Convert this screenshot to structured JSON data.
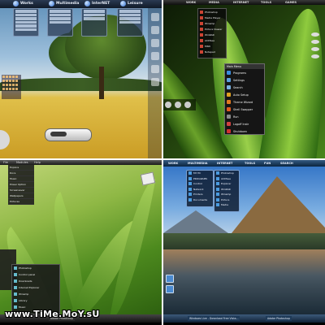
{
  "q1": {
    "tabs": [
      "Works",
      "Multimedia",
      "InterNET",
      "Leisure"
    ],
    "accent": "#2d6bd0"
  },
  "q2": {
    "tabs": [
      "WORK",
      "MEDIA",
      "INTERNET",
      "TOOLS",
      "GAMES"
    ],
    "vpanel_items": [
      "Photoshop",
      "Media Player",
      "Winamp",
      "Picture Viewer",
      "WinRAR",
      "ACDSee",
      "MSN",
      "Notepad"
    ],
    "menu_title": "Main Menu",
    "menu_items": [
      "Programs",
      "Settings",
      "Search",
      "Auto Setup",
      "Theme Wizard",
      "Shell Swapper",
      "Run",
      "Logoff Instr",
      "Shutdown"
    ],
    "menu_colors": [
      "#3a8de0",
      "#5aa0e0",
      "#7ab0e0",
      "#e0a020",
      "#e07a20",
      "#e05a20",
      "#8a8a8a",
      "#d04040",
      "#d03030"
    ]
  },
  "q3": {
    "tabs": [
      "File",
      "Modules",
      "Help"
    ],
    "left_menu_items": [
      "Explore",
      "Docs",
      "Music",
      "Power Option",
      "Screensaver",
      "Wallpapers",
      "Pictures"
    ],
    "bottom_menu_items": [
      "Photoshop",
      "Control panel",
      "Downloads",
      "Internet Explorer",
      "Winamp",
      "Library",
      "Music"
    ],
    "taskbar_items": [
      "Adobe Photoshop"
    ]
  },
  "q4": {
    "tabs": [
      "WORK",
      "MULTIMEDIA",
      "INTERNET",
      "TOOLS",
      "FUN",
      "SEARCH"
    ],
    "panel1_items": [
      "MY PC",
      "PROGRAMS",
      "Control",
      "Network",
      "Printers",
      "Documents"
    ],
    "panel2_items": [
      "Photoshop",
      "ACDSee",
      "Explorer",
      "WinRAR",
      "Winamp",
      "Picture",
      "Media"
    ],
    "taskbar_items": [
      "Windows Live - Download Free Vista...",
      "Adobe Photoshop"
    ]
  },
  "watermark": "www.TiMe.MoY.sU"
}
